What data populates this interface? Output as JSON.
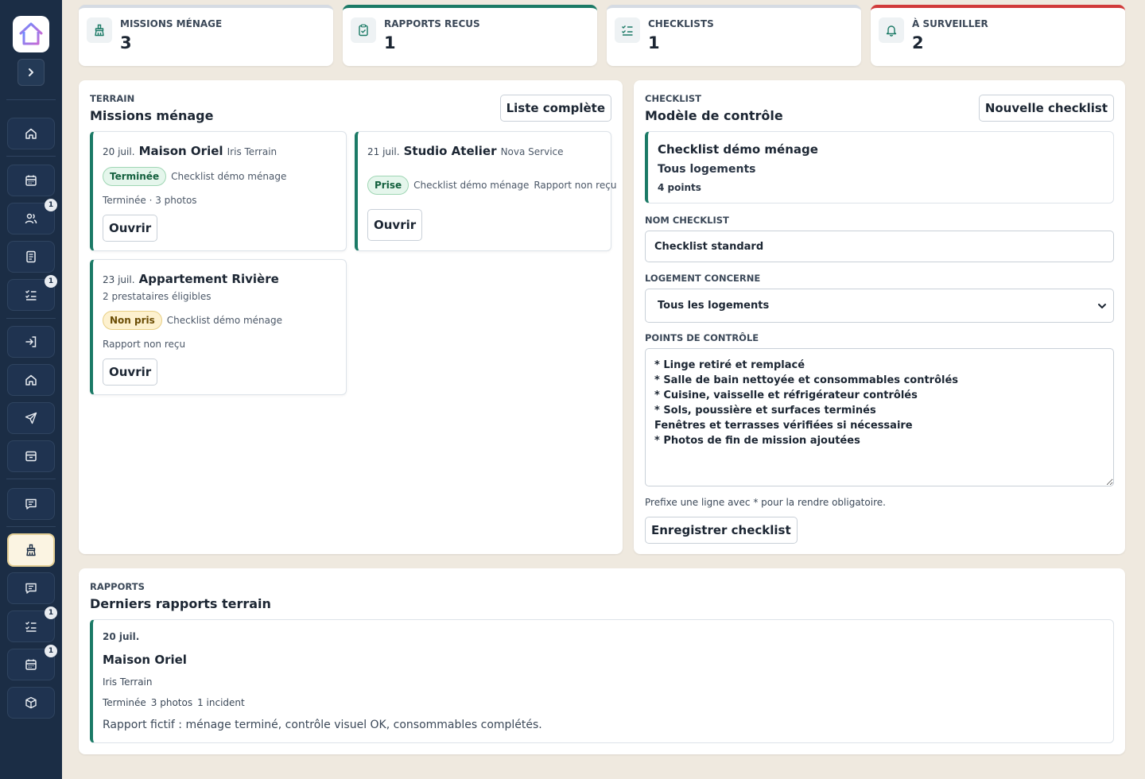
{
  "colors": {
    "sidebar": "#1b2d45",
    "accent": "#1b7a66",
    "alert": "#d13a3a",
    "background": "#efe9df"
  },
  "sidebar": {
    "logo_icon": "house-logo-icon",
    "toggle_icon": "chevron-right-icon",
    "items": [
      {
        "icon": "home-icon",
        "badge": null
      },
      {
        "icon": "calendar-icon",
        "badge": null
      },
      {
        "icon": "users-icon",
        "badge": "1"
      },
      {
        "icon": "document-icon",
        "badge": null
      },
      {
        "icon": "checklist-icon",
        "badge": "1"
      },
      {
        "icon": "login-icon",
        "badge": null
      },
      {
        "icon": "home-icon",
        "badge": null
      },
      {
        "icon": "send-icon",
        "badge": null
      },
      {
        "icon": "inbox-icon",
        "badge": null
      },
      {
        "icon": "message-icon",
        "badge": null
      },
      {
        "icon": "cleaning-icon",
        "badge": null,
        "active": true
      },
      {
        "icon": "message-icon",
        "badge": null
      },
      {
        "icon": "checklist-icon",
        "badge": "1"
      },
      {
        "icon": "calendar-icon",
        "badge": "1"
      },
      {
        "icon": "package-icon",
        "badge": null
      }
    ]
  },
  "stats": [
    {
      "label": "Missions ménage",
      "value": "3",
      "icon": "broom-icon"
    },
    {
      "label": "Rapports recus",
      "value": "1",
      "icon": "clipboard-check-icon"
    },
    {
      "label": "Checklists",
      "value": "1",
      "icon": "list-check-icon"
    },
    {
      "label": "À surveiller",
      "value": "2",
      "icon": "bell-icon"
    }
  ],
  "missions": {
    "eyebrow": "Terrain",
    "title": "Missions ménage",
    "action": "Liste complète",
    "cards": [
      {
        "date": "20 juil.",
        "name": "Maison Oriel",
        "provider": "Iris Terrain",
        "status": "Terminée",
        "checklist": "Checklist démo ménage",
        "meta": "Terminée · 3 photos",
        "open": "Ouvrir"
      },
      {
        "date": "21 juil.",
        "name": "Studio Atelier",
        "provider": "Nova Service",
        "status": "Prise",
        "checklist": "Checklist démo ménage",
        "meta": "Rapport non reçu",
        "open": "Ouvrir"
      },
      {
        "date": "23 juil.",
        "name": "Appartement Rivière",
        "subtitle": "2 prestataires éligibles",
        "status": "Non pris",
        "checklist": "Checklist démo ménage",
        "meta": "Rapport non reçu",
        "open": "Ouvrir"
      }
    ]
  },
  "checklist": {
    "eyebrow": "Checklist",
    "title": "Modèle de contrôle",
    "action": "Nouvelle checklist",
    "template": {
      "name": "Checklist démo ménage",
      "scope": "Tous logements",
      "points": "4 points"
    },
    "name_label": "Nom checklist",
    "name_value": "Checklist standard",
    "housing_label": "Logement concerne",
    "housing_value": "Tous les logements",
    "points_label": "Points de contrôle",
    "points_value": "* Linge retiré et remplacé\n* Salle de bain nettoyée et consommables contrôlés\n* Cuisine, vaisselle et réfrigérateur contrôlés\n* Sols, poussière et surfaces terminés\nFenêtres et terrasses vérifiées si nécessaire\n* Photos de fin de mission ajoutées",
    "hint": "Prefixe une ligne avec * pour la rendre obligatoire.",
    "save": "Enregistrer checklist"
  },
  "reports": {
    "eyebrow": "Rapports",
    "title": "Derniers rapports terrain",
    "items": [
      {
        "date": "20 juil.",
        "name": "Maison Oriel",
        "provider": "Iris Terrain",
        "status": "Terminée",
        "photos": "3 photos",
        "incidents": "1 incident",
        "text": "Rapport fictif : ménage terminé, contrôle visuel OK, consommables complétés."
      }
    ]
  }
}
